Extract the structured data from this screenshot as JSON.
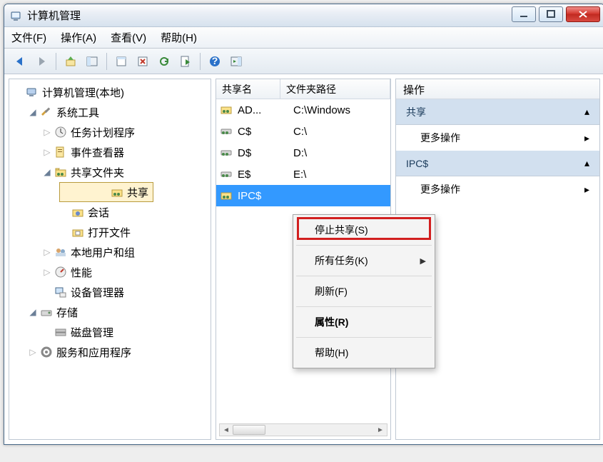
{
  "window": {
    "title": "计算机管理"
  },
  "menu": {
    "file": "文件(F)",
    "action": "操作(A)",
    "view": "查看(V)",
    "help": "帮助(H)"
  },
  "tree": {
    "root": "计算机管理(本地)",
    "sys_tools": "系统工具",
    "task_sched": "任务计划程序",
    "event_viewer": "事件查看器",
    "shared_folders": "共享文件夹",
    "shares": "共享",
    "sessions": "会话",
    "open_files": "打开文件",
    "local_users": "本地用户和组",
    "performance": "性能",
    "device_mgr": "设备管理器",
    "storage": "存储",
    "disk_mgmt": "磁盘管理",
    "svc_apps": "服务和应用程序"
  },
  "list": {
    "col_name": "共享名",
    "col_path": "文件夹路径",
    "rows": [
      {
        "name": "AD...",
        "path": "C:\\Windows"
      },
      {
        "name": "C$",
        "path": "C:\\"
      },
      {
        "name": "D$",
        "path": "D:\\"
      },
      {
        "name": "E$",
        "path": "E:\\"
      },
      {
        "name": "IPC$",
        "path": ""
      }
    ]
  },
  "actions": {
    "header": "操作",
    "section1": "共享",
    "more1": "更多操作",
    "section2": "IPC$",
    "more2": "更多操作"
  },
  "ctx": {
    "stop_share": "停止共享(S)",
    "all_tasks": "所有任务(K)",
    "refresh": "刷新(F)",
    "properties": "属性(R)",
    "help": "帮助(H)"
  }
}
